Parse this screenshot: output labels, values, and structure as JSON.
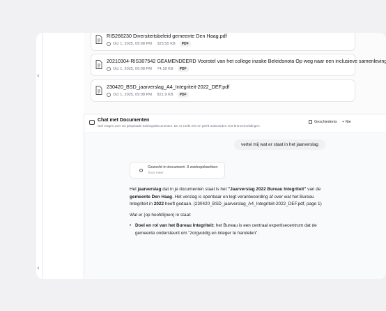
{
  "documents": [
    {
      "title": "RIS266230 Diversiteitsbeleid gemeente Den Haag.pdf",
      "date": "Oct 1, 2025, 09:08 PM",
      "size": "325.55 KB",
      "type": "PDF"
    },
    {
      "title": "20210304-RIS307542 GEAMENDEERD Voorstel van het college inzake Beleidsnota Op weg naar een inclusieve samenleving.",
      "date": "Oct 1, 2025, 09:08 PM",
      "size": "74.18 KB",
      "type": "PDF"
    },
    {
      "title": "230420_BSD_jaarverslag_A4_Integriteit-2022_DEF.pdf",
      "date": "Oct 1, 2025, 09:08 PM",
      "size": "821.9 KB",
      "type": "PDF"
    }
  ],
  "chat": {
    "title": "Chat met Documenten",
    "subtitle": "Stel vragen over uw geüploade trainingsdocumenten. De AI zoekt erin en geeft antwoorden met bronvermeldingen.",
    "history_label": "Geschiedenis",
    "new_label": "+ Nie",
    "user_message": "vertel mij wat er staat in het jaarverslag",
    "tool_title": "Gezocht in document: 3 zoekopdrachten",
    "tool_link": "Toon meer",
    "answer": {
      "p1_a": "Het ",
      "p1_b": "jaarverslag",
      "p1_c": " dat in je documenten staat is het ",
      "p1_d": "\"Jaarverslag 2022 Bureau Integriteit\"",
      "p1_e": " van de ",
      "p1_f": "gemeente Den Haag",
      "p1_g": ". Het verslag is openbaar en legt verantwoording af over wat het Bureau Integriteit in ",
      "p1_h": "2022",
      "p1_i": " heeft gedaan. (230420_BSD_jaarverslag_A4_Integriteit-2022_DEF.pdf, page 1)",
      "p2": "Wat er (op hoofdlijnen) in staat:",
      "bullet_bold": "Doel en rol van het Bureau Integriteit:",
      "bullet_text": " het Bureau is een centraal expertisecentrum dat de gemeente ondersteunt om \"zorgvuldig en integer te handelen\"."
    },
    "send_icon": "arrow-up-icon"
  },
  "colors": {
    "accent": "#c4b5fd",
    "border": "#e3e5e8"
  }
}
